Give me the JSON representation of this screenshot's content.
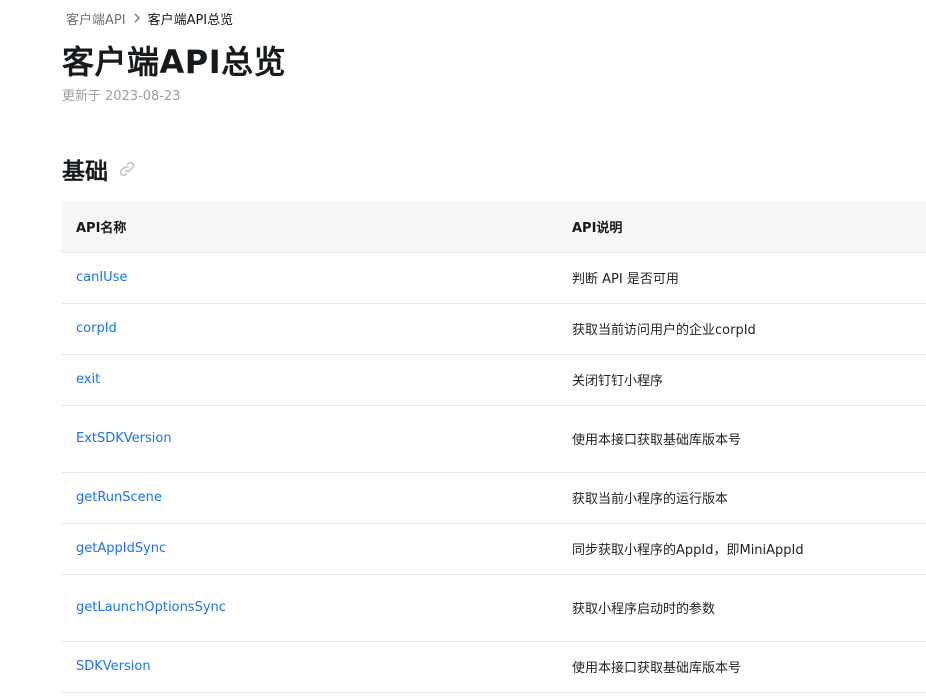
{
  "breadcrumb": {
    "parent": "客户端API",
    "current": "客户端API总览"
  },
  "page": {
    "title": "客户端API总览",
    "updated_label": "更新于",
    "updated_date": "2023-08-23"
  },
  "section": {
    "title": "基础",
    "anchor_icon": "link-icon"
  },
  "table": {
    "headers": [
      "API名称",
      "API说明"
    ],
    "rows": [
      {
        "name": "canIUse",
        "desc": "判断 API 是否可用"
      },
      {
        "name": "corpId",
        "desc": "获取当前访问用户的企业corpId"
      },
      {
        "name": "exit",
        "desc": "关闭钉钉小程序"
      },
      {
        "name": "ExtSDKVersion",
        "desc": "使用本接口获取基础库版本号"
      },
      {
        "name": "getRunScene",
        "desc": "获取当前小程序的运行版本"
      },
      {
        "name": "getAppIdSync",
        "desc": "同步获取小程序的AppId，即MiniAppId"
      },
      {
        "name": "getLaunchOptionsSync",
        "desc": "获取小程序启动时的参数"
      },
      {
        "name": "SDKVersion",
        "desc": "使用本接口获取基础库版本号"
      }
    ]
  },
  "colors": {
    "link": "#1a73e8",
    "text": "#171a1d",
    "muted": "#9a9ea3",
    "header_bg": "#f6f6f7",
    "border": "#e6e7e8"
  }
}
